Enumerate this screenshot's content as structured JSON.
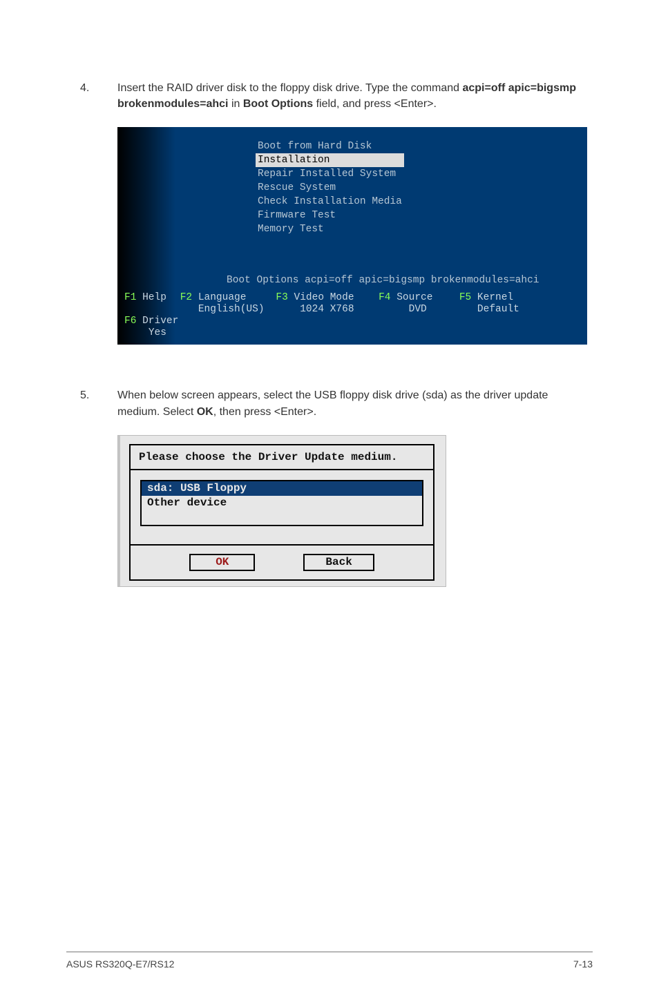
{
  "step4": {
    "num": "4.",
    "text_pre": "Insert the RAID driver disk to the floppy disk drive. Type the command ",
    "bold1": "acpi=off apic=bigsmp brokenmodules=ahci",
    "mid": " in ",
    "bold2": "Boot Options",
    "after": " field, and press <Enter>."
  },
  "bootmenu": {
    "items": [
      "Boot from Hard Disk",
      "Installation",
      "Repair Installed System",
      "Rescue System",
      "Check Installation Media",
      "Firmware Test",
      "Memory Test"
    ],
    "boot_options_label": "Boot Options",
    "boot_options_value": "acpi=off apic=bigsmp brokenmodules=ahci",
    "fkeys": {
      "f1": "F1",
      "f1_label": "Help",
      "f2": "F2",
      "f2_label": "Language",
      "f2_sub": "English(US)",
      "f3": "F3",
      "f3_label": "Video Mode",
      "f3_sub": "1024 X768",
      "f4": "F4",
      "f4_label": "Source",
      "f4_sub": "DVD",
      "f5": "F5",
      "f5_label": "Kernel",
      "f5_sub": "Default",
      "f6": "F6",
      "f6_label": "Driver",
      "f6_sub": "Yes"
    }
  },
  "step5": {
    "num": "5.",
    "text_pre": "When below screen appears, select the USB floppy disk drive (sda) as the driver update medium. Select ",
    "bold1": "OK",
    "after": ", then press <Enter>."
  },
  "dialog": {
    "title": "Please choose the Driver Update medium.",
    "items": [
      "sda: USB Floppy",
      "Other device"
    ],
    "ok": "OK",
    "back": "Back"
  },
  "footer": {
    "left": "ASUS RS320Q-E7/RS12",
    "right": "7-13"
  }
}
